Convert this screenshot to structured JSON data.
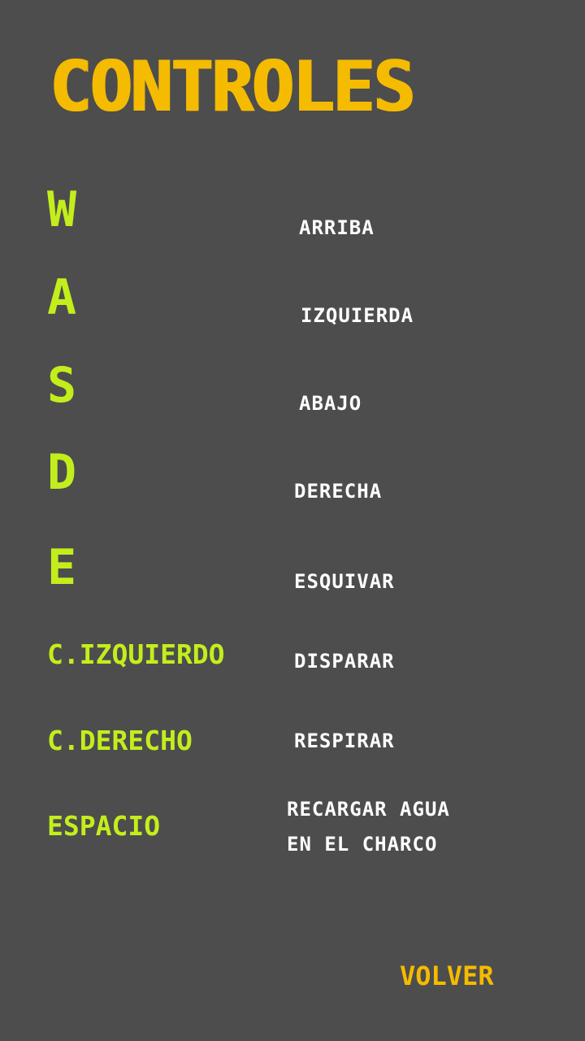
{
  "title": "CONTROLES",
  "controls": [
    {
      "key": "W",
      "action": "ARRIBA"
    },
    {
      "key": "A",
      "action": "IZQUIERDA"
    },
    {
      "key": "S",
      "action": "ABAJO"
    },
    {
      "key": "D",
      "action": "DERECHA"
    },
    {
      "key": "E",
      "action": "ESQUIVAR"
    },
    {
      "key": "C.IZQUIERDO",
      "action": "DISPARAR"
    },
    {
      "key": "C.DERECHO",
      "action": "RESPIRAR"
    },
    {
      "key": "ESPACIO",
      "action_line1": "RECARGAR AGUA",
      "action_line2": "EN EL CHARCO"
    }
  ],
  "back_label": "VOLVER",
  "colors": {
    "background": "#4d4d4d",
    "title": "#f5bb00",
    "key": "#c3ee1c",
    "action": "#ffffff"
  }
}
